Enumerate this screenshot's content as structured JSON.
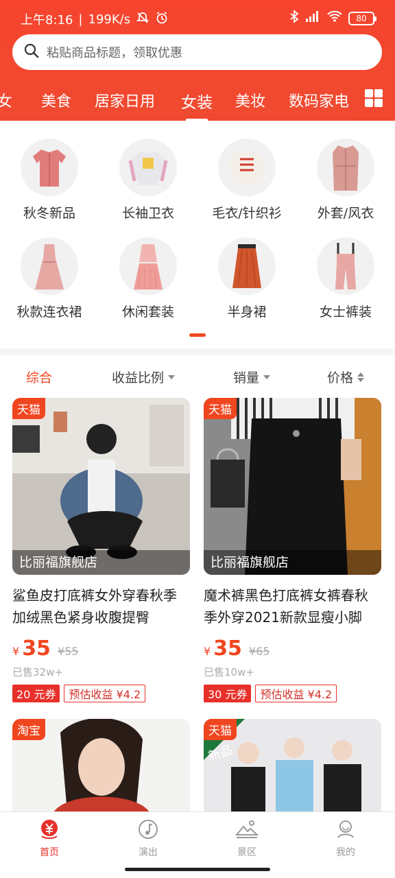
{
  "status": {
    "time": "上午8:16",
    "speed": "199K/s",
    "battery": "80"
  },
  "search": {
    "placeholder": "粘贴商品标题，领取优惠"
  },
  "tabs": [
    {
      "label": "女"
    },
    {
      "label": "美食"
    },
    {
      "label": "居家日用"
    },
    {
      "label": "女装"
    },
    {
      "label": "美妆"
    },
    {
      "label": "数码家电"
    }
  ],
  "categories": [
    {
      "label": "秋冬新品",
      "icon": "pink-jacket-icon"
    },
    {
      "label": "长袖卫衣",
      "icon": "sweatshirt-icon"
    },
    {
      "label": "毛衣/针织衫",
      "icon": "sweater-icon"
    },
    {
      "label": "外套/风衣",
      "icon": "trench-coat-icon"
    },
    {
      "label": "秋款连衣裙",
      "icon": "dress-icon"
    },
    {
      "label": "休闲套装",
      "icon": "casual-set-icon"
    },
    {
      "label": "半身裙",
      "icon": "skirt-icon"
    },
    {
      "label": "女士裤装",
      "icon": "overalls-icon"
    }
  ],
  "sort": {
    "overall": "综合",
    "ratio": "收益比例",
    "sales": "销量",
    "price": "价格"
  },
  "products": [
    {
      "badge": "天猫",
      "shop": "比丽福旗舰店",
      "title": "鲨鱼皮打底裤女外穿春秋季加绒黑色紧身收腹提臀",
      "yen": "¥",
      "price": "35",
      "original": "¥55",
      "sold": "已售32w+",
      "coupon": "20 元券",
      "earn": "预估收益 ¥4.2"
    },
    {
      "badge": "天猫",
      "shop": "比丽福旗舰店",
      "title": "魔术裤黑色打底裤女裤春秋季外穿2021新款显瘦小脚",
      "yen": "¥",
      "price": "35",
      "original": "¥65",
      "sold": "已售10w+",
      "coupon": "30 元券",
      "earn": "预估收益 ¥4.2"
    },
    {
      "badge": "淘宝"
    },
    {
      "badge": "天猫",
      "promo": "新品"
    }
  ],
  "nav": [
    {
      "label": "首页"
    },
    {
      "label": "演出"
    },
    {
      "label": "景区"
    },
    {
      "label": "我的"
    }
  ],
  "colors": {
    "brand": "#f0461f",
    "header": "#f2482f"
  }
}
